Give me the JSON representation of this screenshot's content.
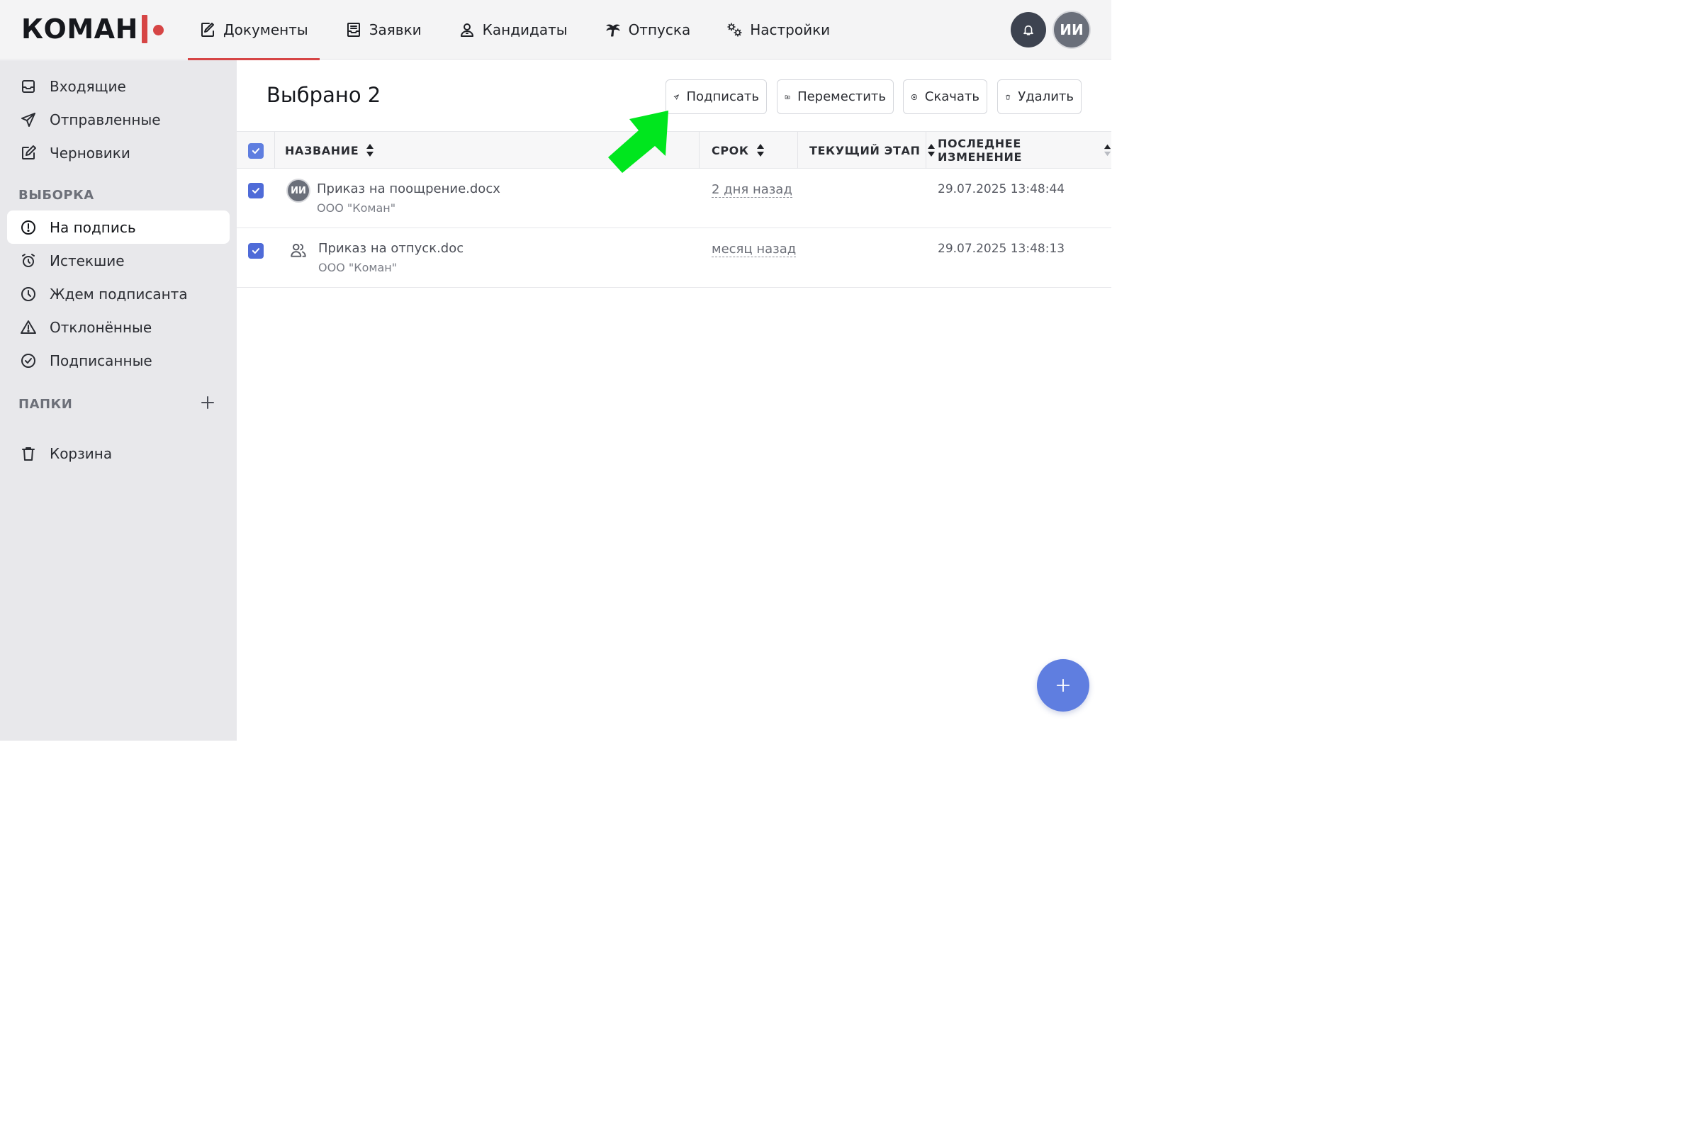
{
  "brand": {
    "name": "КОМАН",
    "accent": "#d64545"
  },
  "nav": {
    "items": [
      {
        "label": "Документы",
        "icon": "document-edit-icon",
        "active": true
      },
      {
        "label": "Заявки",
        "icon": "inbox-tray-icon"
      },
      {
        "label": "Кандидаты",
        "icon": "person-badge-icon"
      },
      {
        "label": "Отпуска",
        "icon": "palm-tree-icon"
      },
      {
        "label": "Настройки",
        "icon": "gears-icon"
      }
    ],
    "user_initials": "ИИ"
  },
  "sidebar": {
    "items": [
      {
        "label": "Входящие",
        "icon": "inbox-icon"
      },
      {
        "label": "Отправленные",
        "icon": "send-icon"
      },
      {
        "label": "Черновики",
        "icon": "edit-icon"
      }
    ],
    "filter_title": "ВЫБОРКА",
    "filters": [
      {
        "label": "На подпись",
        "icon": "alert-circle-icon",
        "active": true
      },
      {
        "label": "Истекшие",
        "icon": "alarm-clock-icon"
      },
      {
        "label": "Ждем подписанта",
        "icon": "clock-icon"
      },
      {
        "label": "Отклонённые",
        "icon": "warning-triangle-icon"
      },
      {
        "label": "Подписанные",
        "icon": "check-circle-icon"
      }
    ],
    "folders_title": "ПАПКИ",
    "trash_label": "Корзина"
  },
  "main": {
    "selected_title": "Выбрано 2",
    "actions": {
      "sign": "Подписать",
      "move": "Переместить",
      "download": "Скачать",
      "delete": "Удалить"
    },
    "columns": {
      "name": "НАЗВАНИЕ",
      "due": "СРОК",
      "stage": "ТЕКУЩИЙ ЭТАП",
      "changed": "ПОСЛЕДНЕЕ ИЗМЕНЕНИЕ"
    },
    "rows": [
      {
        "name": "Приказ на поощрение.docx",
        "org": "ООО \"Коман\"",
        "due": "2 дня назад",
        "stage": "",
        "changed": "29.07.2025 13:48:44",
        "avatar": "ИИ",
        "checked": true
      },
      {
        "name": "Приказ на отпуск.doc",
        "org": "ООО \"Коман\"",
        "due": "месяц назад",
        "stage": "",
        "changed": "29.07.2025 13:48:13",
        "icon": "group-icon",
        "checked": true
      }
    ]
  },
  "colors": {
    "primary": "#5f7ee0",
    "checkbox": "#4f6bd8",
    "annotation_arrow": "#00e61e"
  }
}
